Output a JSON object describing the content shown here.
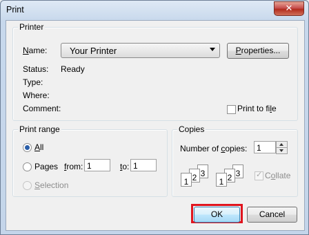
{
  "window": {
    "title": "Print",
    "close_label": "✕"
  },
  "printer": {
    "group_label": "Printer",
    "name_label": "Name:",
    "name_value": "Your Printer",
    "properties_label": "Properties...",
    "status_label": "Status:",
    "status_value": "Ready",
    "type_label": "Type:",
    "where_label": "Where:",
    "comment_label": "Comment:",
    "print_to_file_label": "Print to file"
  },
  "range": {
    "group_label": "Print range",
    "all_label": "All",
    "pages_label": "Pages",
    "from_label": "from:",
    "from_value": "1",
    "to_label": "to:",
    "to_value": "1",
    "selection_label": "Selection",
    "selected": "All"
  },
  "copies": {
    "group_label": "Copies",
    "number_label": "Number of copies:",
    "number_value": "1",
    "collate_label": "Collate",
    "collate_checked": true,
    "page_numbers": [
      "1",
      "2",
      "3"
    ]
  },
  "buttons": {
    "ok": "OK",
    "cancel": "Cancel"
  },
  "colors": {
    "highlight": "#e0141e",
    "accent": "#2a5ea8"
  }
}
